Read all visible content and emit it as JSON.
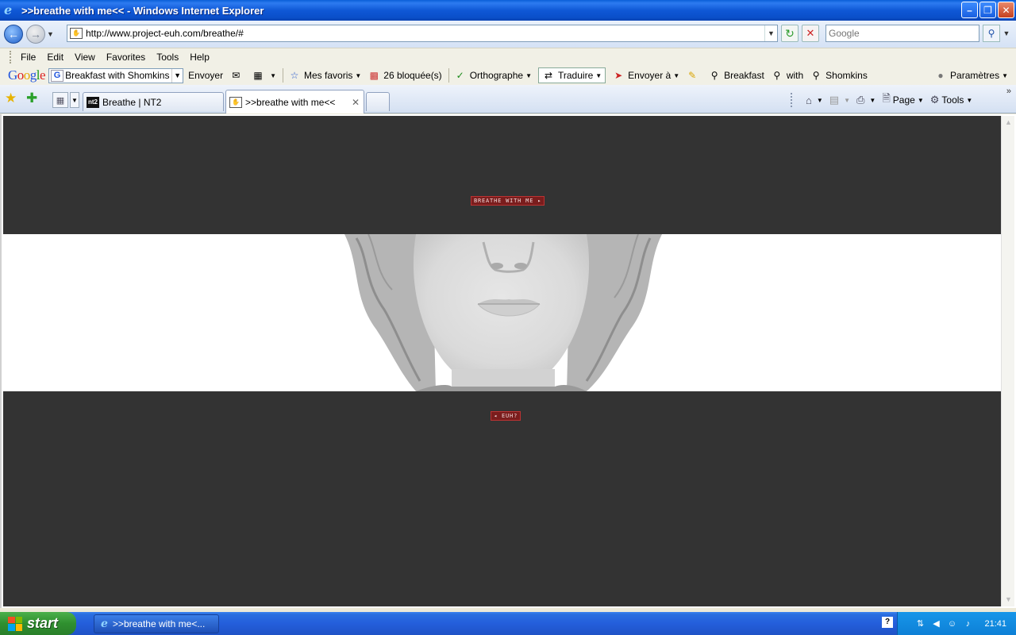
{
  "window": {
    "title": ">>breathe with me<< - Windows Internet Explorer"
  },
  "address": {
    "url": "http://www.project-euh.com/breathe/#",
    "search_placeholder": "Google"
  },
  "menu": [
    "File",
    "Edit",
    "View",
    "Favorites",
    "Tools",
    "Help"
  ],
  "google_toolbar": {
    "logo": "Google",
    "search_value": "Breakfast with Shomkins",
    "send_label": "Envoyer",
    "favorites_label": "Mes favoris",
    "blocked_label": "26 bloquée(s)",
    "spell_label": "Orthographe",
    "translate_label": "Traduire",
    "send_to_label": "Envoyer à",
    "terms": [
      "Breakfast",
      "with",
      "Shomkins"
    ],
    "settings_label": "Paramètres"
  },
  "tabs": [
    {
      "label": "Breathe | NT2",
      "icon": "nt2"
    },
    {
      "label": ">>breathe with me<<",
      "icon": "hand-icon"
    }
  ],
  "command_bar": {
    "page_label": "Page",
    "tools_label": "Tools"
  },
  "page": {
    "breathe_button": "BREATHE WITH ME ▸",
    "euh_button": "◂ EUH?",
    "colors": {
      "band": "#333333",
      "pill": "#7a1d1d"
    }
  },
  "taskbar": {
    "start_label": "start",
    "task_label": ">>breathe with me<...",
    "clock": "21:41"
  }
}
